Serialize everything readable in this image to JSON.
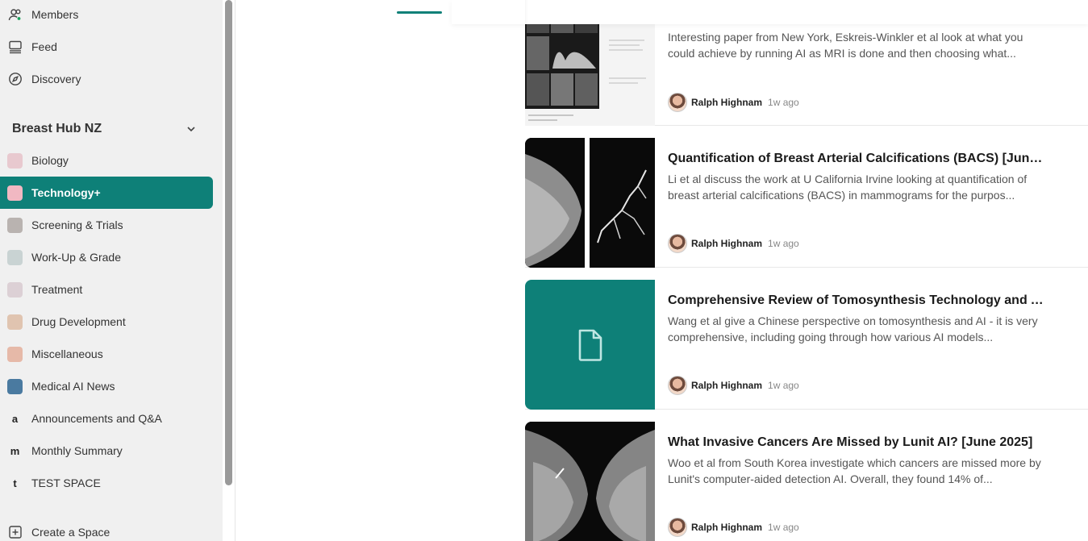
{
  "sidebar": {
    "nav": [
      {
        "label": "Members",
        "icon": "members-icon"
      },
      {
        "label": "Feed",
        "icon": "feed-icon"
      },
      {
        "label": "Discovery",
        "icon": "compass-icon"
      }
    ],
    "group_title": "Breast Hub NZ",
    "spaces": [
      {
        "label": "Biology",
        "type": "thumb",
        "color": "#e8c9cf"
      },
      {
        "label": "Technology+",
        "type": "thumb",
        "color": "#f1b8c2",
        "active": true
      },
      {
        "label": "Screening & Trials",
        "type": "thumb",
        "color": "#b9b3b0"
      },
      {
        "label": "Work-Up & Grade",
        "type": "thumb",
        "color": "#c9d3d3"
      },
      {
        "label": "Treatment",
        "type": "thumb",
        "color": "#dcd0d5"
      },
      {
        "label": "Drug Development",
        "type": "thumb",
        "color": "#e0c4b0"
      },
      {
        "label": "Miscellaneous",
        "type": "thumb",
        "color": "#e6b9a8"
      },
      {
        "label": "Medical AI News",
        "type": "thumb",
        "color": "#4a7aa0"
      },
      {
        "label": "Announcements and Q&A",
        "type": "letter",
        "letter": "a"
      },
      {
        "label": "Monthly Summary",
        "type": "letter",
        "letter": "m"
      },
      {
        "label": "TEST SPACE",
        "type": "letter",
        "letter": "t"
      }
    ],
    "create_label": "Create a Space"
  },
  "colors": {
    "accent": "#0e8078",
    "sidebar_bg": "#f0f0f0"
  },
  "posts": [
    {
      "title": "",
      "excerpt": "Interesting paper from New York, Eskreis-Winkler et al look at what you could achieve by running AI as MRI is done and then choosing what...",
      "author": "Ralph Highnam",
      "time": "1w ago",
      "media": "mri-slides"
    },
    {
      "title": "Quantification of Breast Arterial Calcifications (BACS) [June...",
      "excerpt": "Li et al discuss the work at U California Irvine looking at quantification of breast arterial calcifications (BACS) in mammograms for the purpos...",
      "author": "Ralph Highnam",
      "time": "1w ago",
      "media": "mammogram-calcifications"
    },
    {
      "title": "Comprehensive Review of Tomosynthesis Technology and A...",
      "excerpt": "Wang et al give a Chinese perspective on tomosynthesis and AI - it is very comprehensive, including going through how various AI models...",
      "author": "Ralph Highnam",
      "time": "1w ago",
      "media": "document-icon"
    },
    {
      "title": "What Invasive Cancers Are Missed by Lunit AI? [June 2025]",
      "excerpt": "Woo et al from South Korea investigate which cancers are missed more by Lunit's computer-aided detection AI. Overall, they found 14% of...",
      "author": "Ralph Highnam",
      "time": "1w ago",
      "media": "mammogram-pair"
    }
  ]
}
